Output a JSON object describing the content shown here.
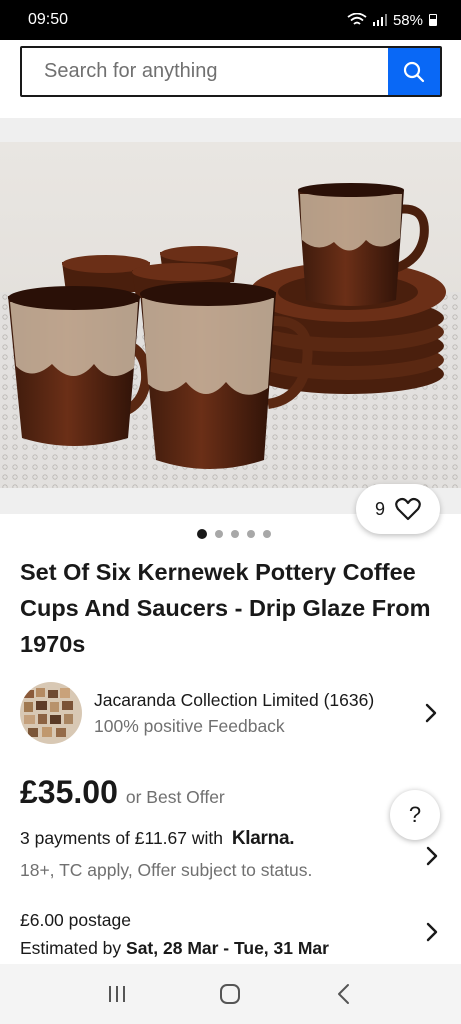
{
  "status_bar": {
    "time": "09:50",
    "battery": "58%"
  },
  "search": {
    "placeholder": "Search for anything"
  },
  "listing": {
    "watch_count": "9",
    "image_count": 5,
    "active_image": 1,
    "title": "Set Of Six Kernewek Pottery Coffee Cups And Saucers - Drip Glaze From 1970s"
  },
  "seller": {
    "name": "Jacaranda Collection Limited (1636)",
    "feedback": "100% positive Feedback"
  },
  "price": {
    "amount": "£35.00",
    "best_offer": "or Best Offer"
  },
  "klarna": {
    "payments_text": "3 payments of £11.67 with",
    "logo": "Klarna.",
    "terms": "18+, TC apply, Offer subject to status."
  },
  "postage": {
    "cost": "£6.00 postage",
    "estimated_label": "Estimated by",
    "dates": "Sat, 28 Mar - Tue, 31 Mar"
  },
  "help": {
    "label": "?"
  },
  "colors": {
    "accent": "#0968f6",
    "text": "#191919",
    "secondary": "#707070"
  },
  "icons": [
    "search-icon",
    "heart-icon",
    "chevron-right-icon",
    "recent-apps-icon",
    "home-icon",
    "back-icon"
  ]
}
